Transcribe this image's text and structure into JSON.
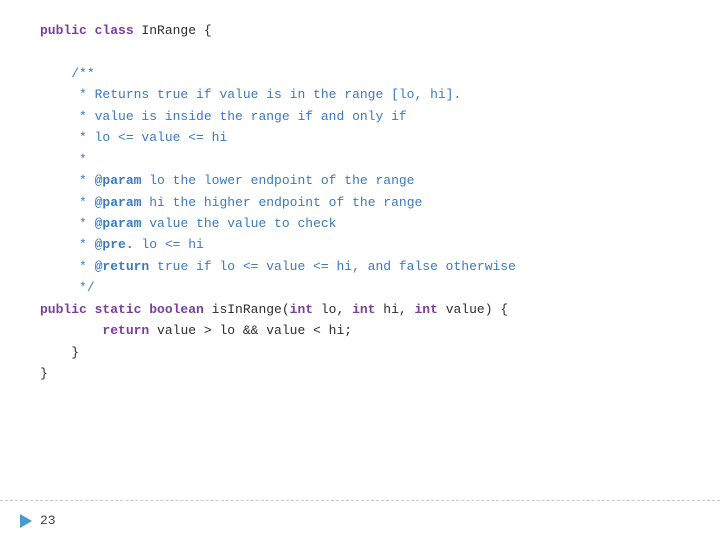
{
  "code": {
    "lines": [
      {
        "id": "l1",
        "indent": 0,
        "parts": [
          {
            "text": "public ",
            "class": "kw"
          },
          {
            "text": "class ",
            "class": "kw"
          },
          {
            "text": "InRange {",
            "class": "plain"
          }
        ]
      },
      {
        "id": "l2",
        "indent": 0,
        "parts": [
          {
            "text": "",
            "class": "plain"
          }
        ]
      },
      {
        "id": "l3",
        "indent": 1,
        "parts": [
          {
            "text": "/**",
            "class": "cm"
          }
        ]
      },
      {
        "id": "l4",
        "indent": 1,
        "parts": [
          {
            "text": " * Returns true if value is in the range [lo, hi].",
            "class": "cm"
          }
        ]
      },
      {
        "id": "l5",
        "indent": 1,
        "parts": [
          {
            "text": " * value is inside the range if ",
            "class": "cm"
          },
          {
            "text": "and",
            "class": "cm"
          },
          {
            "text": " only if",
            "class": "cm"
          }
        ]
      },
      {
        "id": "l6",
        "indent": 1,
        "parts": [
          {
            "text": " * lo <= value <= hi",
            "class": "cm"
          }
        ]
      },
      {
        "id": "l7",
        "indent": 1,
        "parts": [
          {
            "text": " *",
            "class": "cm"
          }
        ]
      },
      {
        "id": "l8",
        "indent": 1,
        "parts": [
          {
            "text": " * ",
            "class": "cm"
          },
          {
            "text": "@param",
            "class": "cm-tag"
          },
          {
            "text": " lo the lower endpoint of the range",
            "class": "cm"
          }
        ]
      },
      {
        "id": "l9",
        "indent": 1,
        "parts": [
          {
            "text": " * ",
            "class": "cm"
          },
          {
            "text": "@param",
            "class": "cm-tag"
          },
          {
            "text": " hi the ",
            "class": "cm"
          },
          {
            "text": "higher",
            "class": "cm"
          },
          {
            "text": " endpoint of the range",
            "class": "cm"
          }
        ]
      },
      {
        "id": "l10",
        "indent": 1,
        "parts": [
          {
            "text": " * ",
            "class": "cm"
          },
          {
            "text": "@param",
            "class": "cm-tag"
          },
          {
            "text": " value the value to check",
            "class": "cm"
          }
        ]
      },
      {
        "id": "l11",
        "indent": 1,
        "parts": [
          {
            "text": " * ",
            "class": "cm"
          },
          {
            "text": "@pre.",
            "class": "cm-tag"
          },
          {
            "text": " lo <= hi",
            "class": "cm"
          }
        ]
      },
      {
        "id": "l12",
        "indent": 1,
        "parts": [
          {
            "text": " * ",
            "class": "cm"
          },
          {
            "text": "@return",
            "class": "cm-tag"
          },
          {
            "text": " true if lo <= value <= hi, ",
            "class": "cm"
          },
          {
            "text": "and",
            "class": "cm"
          },
          {
            "text": " false otherwise",
            "class": "cm"
          }
        ]
      },
      {
        "id": "l13",
        "indent": 1,
        "parts": [
          {
            "text": " */",
            "class": "cm"
          }
        ]
      },
      {
        "id": "l14",
        "indent": 0,
        "parts": [
          {
            "text": "public ",
            "class": "kw"
          },
          {
            "text": "static ",
            "class": "kw"
          },
          {
            "text": "boolean ",
            "class": "kw"
          },
          {
            "text": "isInRange(",
            "class": "plain"
          },
          {
            "text": "int",
            "class": "kw"
          },
          {
            "text": " lo, ",
            "class": "plain"
          },
          {
            "text": "int",
            "class": "kw"
          },
          {
            "text": " hi, ",
            "class": "plain"
          },
          {
            "text": "int",
            "class": "kw"
          },
          {
            "text": " value) {",
            "class": "plain"
          }
        ]
      },
      {
        "id": "l15",
        "indent": 2,
        "parts": [
          {
            "text": "return",
            "class": "kw"
          },
          {
            "text": " value > lo && value < hi;",
            "class": "plain"
          }
        ]
      },
      {
        "id": "l16",
        "indent": 1,
        "parts": [
          {
            "text": "}",
            "class": "plain"
          }
        ]
      },
      {
        "id": "l17",
        "indent": 0,
        "parts": [
          {
            "text": "}",
            "class": "plain"
          }
        ]
      }
    ]
  },
  "bottom": {
    "slide_number": "23"
  }
}
